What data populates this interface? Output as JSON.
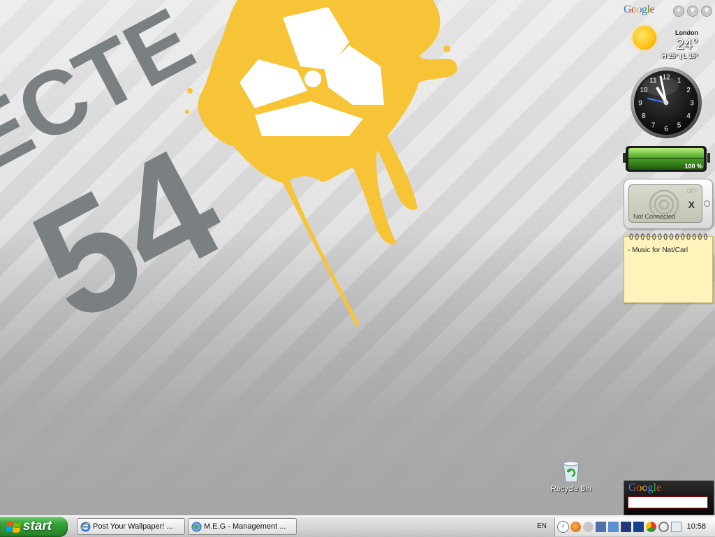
{
  "wallpaper": {
    "big_text_top": "ECTE",
    "big_number": "54",
    "colors": {
      "grey_text": "#7a7f82",
      "splat": "#f7c437"
    }
  },
  "sidebar": {
    "google_header": {
      "logo": "Google",
      "add_icon": "plus-icon",
      "menu_icon": "down-arrow-icon"
    },
    "weather": {
      "city": "London",
      "temperature": "24°",
      "high_low": "H 25° | L 15°",
      "icon": "sun-icon"
    },
    "clock": {
      "numerals": [
        "12",
        "1",
        "2",
        "3",
        "4",
        "5",
        "6",
        "7",
        "8",
        "9",
        "10",
        "11"
      ],
      "time_hours": 10,
      "time_minutes": 58
    },
    "battery": {
      "label": "100 %",
      "level": 1.0
    },
    "wireless": {
      "status": "Not Connected",
      "off_label": "OFF",
      "x": "X"
    },
    "notes": {
      "text": "- Music for Nat/Carl"
    },
    "google_search": {
      "logo": "Google",
      "value": ""
    }
  },
  "desktop_icons": [
    {
      "label": "Recycle Bin",
      "icon": "recycle-bin-icon"
    }
  ],
  "taskbar": {
    "start_label": "start",
    "tasks": [
      {
        "label": "Post Your Wallpaper! ...",
        "icon": "internet-explorer-icon"
      },
      {
        "label": "M.E.G - Management ...",
        "icon": "globe-icon"
      }
    ],
    "language": "EN",
    "time": "10:58"
  }
}
